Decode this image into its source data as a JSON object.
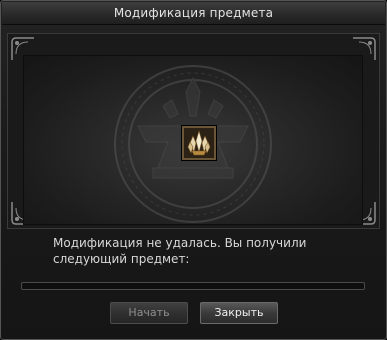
{
  "window": {
    "title": "Модификация предмета"
  },
  "result": {
    "message": "Модификация не удалась. Вы получили следующий предмет:",
    "item_icon": "crystal-icon"
  },
  "progress": {
    "value": 0
  },
  "buttons": {
    "start_label": "Начать",
    "close_label": "Закрыть"
  }
}
